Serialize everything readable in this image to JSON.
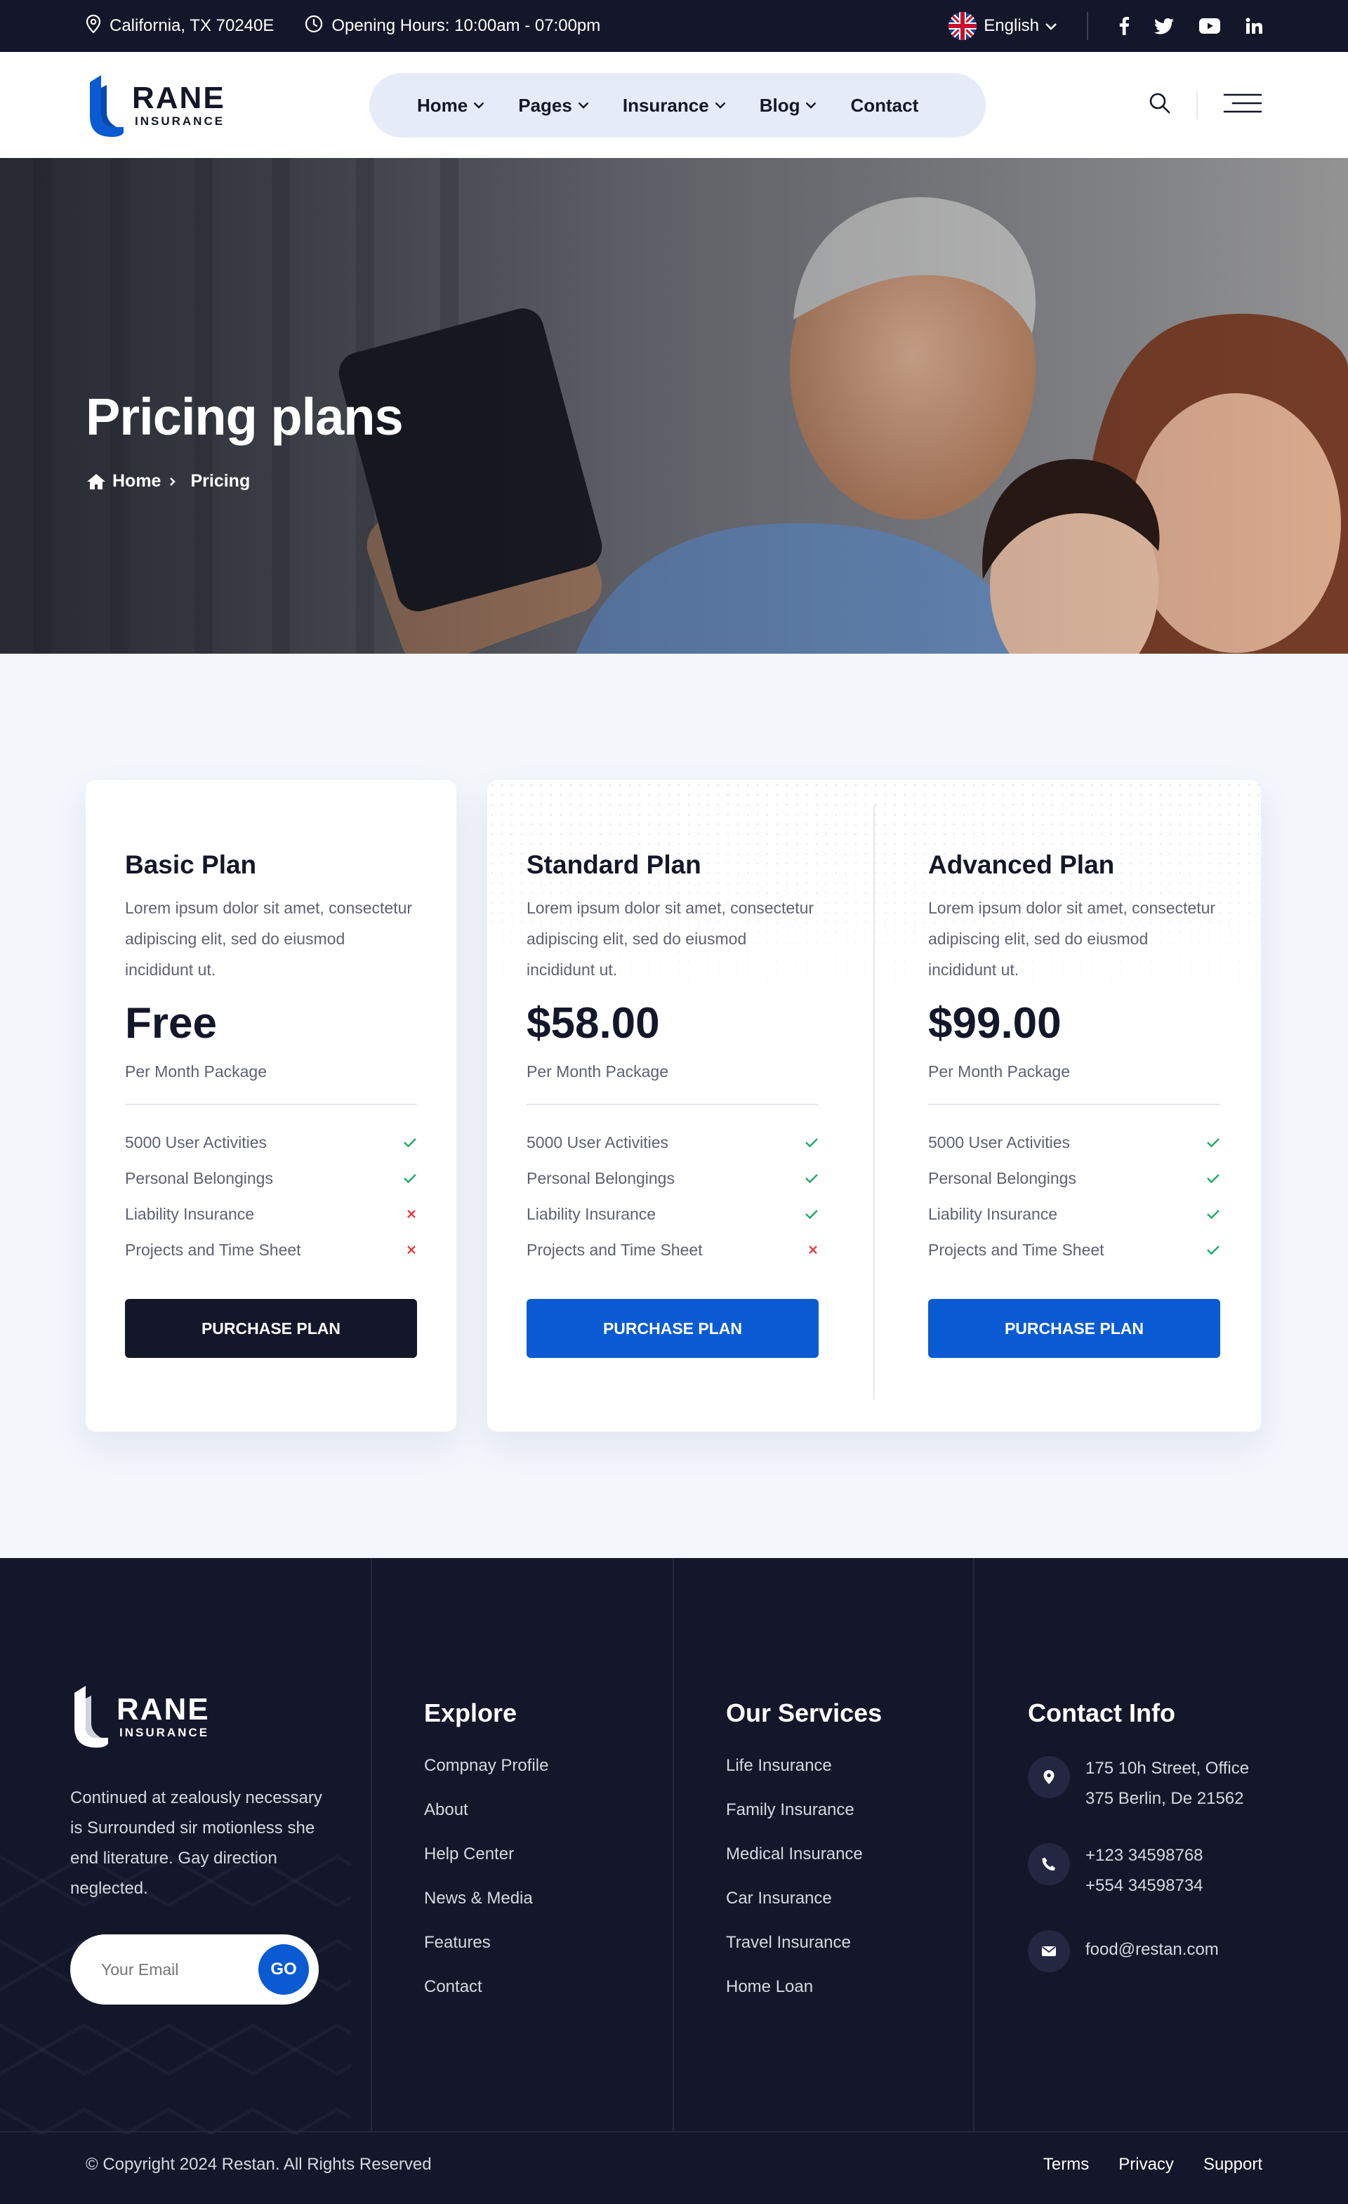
{
  "topbar": {
    "location": "California, TX 70240E",
    "hours": "Opening Hours: 10:00am - 07:00pm",
    "language": "English"
  },
  "brand": {
    "name": "RANE",
    "tagline": "INSURANCE",
    "primary_color": "#0a5bd3",
    "dark_color": "#141729"
  },
  "nav": {
    "items": [
      {
        "label": "Home",
        "dropdown": true
      },
      {
        "label": "Pages",
        "dropdown": true
      },
      {
        "label": "Insurance",
        "dropdown": true
      },
      {
        "label": "Blog",
        "dropdown": true
      },
      {
        "label": "Contact",
        "dropdown": false
      }
    ]
  },
  "hero": {
    "title": "Pricing plans",
    "breadcrumb": [
      "Home",
      "Pricing"
    ]
  },
  "plans": [
    {
      "name": "Basic Plan",
      "description": "Lorem ipsum dolor sit amet, consectetur adipiscing elit, sed do eiusmod incididunt ut.",
      "price": "Free",
      "period": "Per Month Package",
      "features": [
        {
          "label": "5000 User Activities",
          "included": true
        },
        {
          "label": "Personal Belongings",
          "included": true
        },
        {
          "label": "Liability Insurance",
          "included": false
        },
        {
          "label": "Projects and Time Sheet",
          "included": false
        }
      ],
      "button": "PURCHASE PLAN"
    },
    {
      "name": "Standard Plan",
      "description": "Lorem ipsum dolor sit amet, consectetur adipiscing elit, sed do eiusmod incididunt ut.",
      "price": "$58.00",
      "period": "Per Month Package",
      "features": [
        {
          "label": "5000 User Activities",
          "included": true
        },
        {
          "label": "Personal Belongings",
          "included": true
        },
        {
          "label": "Liability Insurance",
          "included": true
        },
        {
          "label": "Projects and Time Sheet",
          "included": false
        }
      ],
      "button": "PURCHASE PLAN"
    },
    {
      "name": "Advanced Plan",
      "description": "Lorem ipsum dolor sit amet, consectetur adipiscing elit, sed do eiusmod incididunt ut.",
      "price": "$99.00",
      "period": "Per Month Package",
      "features": [
        {
          "label": "5000 User Activities",
          "included": true
        },
        {
          "label": "Personal Belongings",
          "included": true
        },
        {
          "label": "Liability Insurance",
          "included": true
        },
        {
          "label": "Projects and Time Sheet",
          "included": true
        }
      ],
      "button": "PURCHASE PLAN"
    }
  ],
  "footer": {
    "about": "Continued at zealously necessary is Surrounded sir motionless she end literature. Gay direction neglected.",
    "subscribe": {
      "placeholder": "Your Email",
      "button": "GO"
    },
    "explore": {
      "title": "Explore",
      "links": [
        "Compnay Profile",
        "About",
        "Help Center",
        "News & Media",
        "Features",
        "Contact"
      ]
    },
    "services": {
      "title": "Our Services",
      "links": [
        "Life Insurance",
        "Family Insurance",
        "Medical Insurance",
        "Car Insurance",
        "Travel Insurance",
        "Home Loan"
      ]
    },
    "contact": {
      "title": "Contact Info",
      "address": [
        "175 10h Street, Office",
        "375 Berlin, De 21562"
      ],
      "phones": [
        "+123 34598768",
        "+554 34598734"
      ],
      "email": "food@restan.com"
    },
    "copyright": "© Copyright 2024 Restan. All Rights Reserved",
    "bottom_links": [
      "Terms",
      "Privacy",
      "Support"
    ]
  }
}
